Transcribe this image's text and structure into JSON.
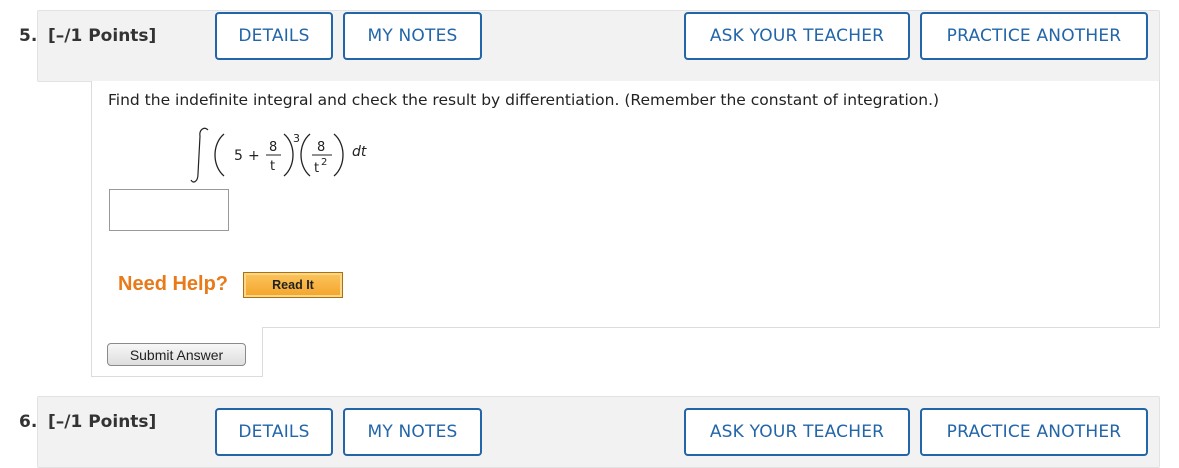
{
  "question5": {
    "number": "5.",
    "points": "[–/1 Points]",
    "buttons": {
      "details": "DETAILS",
      "my_notes": "MY NOTES",
      "ask_teacher": "ASK YOUR TEACHER",
      "practice_another": "PRACTICE ANOTHER"
    },
    "prompt": "Find the indefinite integral and check the result by differentiation. (Remember the constant of integration.)",
    "math": {
      "five": "5",
      "plus": "+",
      "num1": "8",
      "den1": "t",
      "power": "3",
      "num2": "8",
      "den2": "t",
      "den2_exp": "2",
      "dt": "dt"
    },
    "answer_value": "",
    "need_help": "Need Help?",
    "read_it": "Read It",
    "submit": "Submit Answer"
  },
  "question6": {
    "number": "6.",
    "points": "[–/1 Points]",
    "buttons": {
      "details": "DETAILS",
      "my_notes": "MY NOTES",
      "ask_teacher": "ASK YOUR TEACHER",
      "practice_another": "PRACTICE ANOTHER"
    }
  },
  "colors": {
    "accent_blue": "#2265a8",
    "help_orange": "#e87a1a",
    "header_bg": "#f2f2f2"
  }
}
